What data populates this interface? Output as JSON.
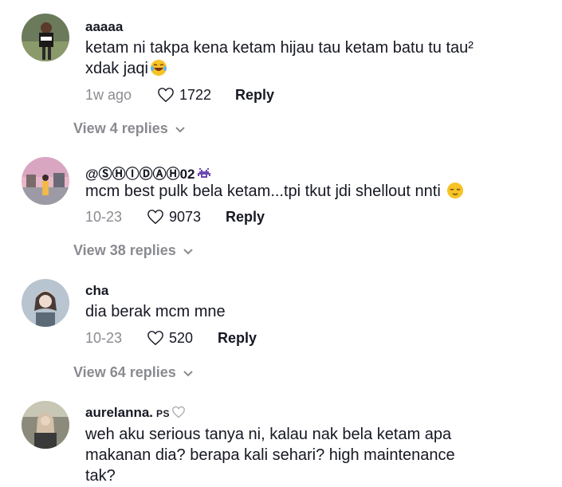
{
  "comments": [
    {
      "username": "aaaaa",
      "text_line1": "ketam ni takpa kena ketam hijau tau ketam batu tu tau²",
      "text_line2": "xdak jaqi",
      "date": "1w ago",
      "likes": "1722",
      "reply_label": "Reply",
      "view_replies": "View 4 replies"
    },
    {
      "username": "@ⓈⒽⒾⒹⒶⒽ02",
      "text_line1": "mcm best pulk bela ketam...tpi tkut jdi shellout nnti",
      "date": "10-23",
      "likes": "9073",
      "reply_label": "Reply",
      "view_replies": "View 38 replies"
    },
    {
      "username": "cha",
      "text_line1": "dia berak mcm mne",
      "date": "10-23",
      "likes": "520",
      "reply_label": "Reply",
      "view_replies": "View 64 replies"
    },
    {
      "username": "aurelanna.",
      "badge": "PS",
      "text_line1": "weh aku serious tanya ni, kalau nak bela ketam apa",
      "text_line2": "makanan dia? berapa kali sehari? high maintenance",
      "text_line3": "tak?"
    }
  ],
  "icons": {
    "like": "heart-outline-icon",
    "expand": "chevron-down-icon",
    "emoji_laugh": "laughing-emoji-icon",
    "emoji_relieved": "relieved-emoji-icon",
    "invader": "space-invader-icon"
  },
  "colors": {
    "text": "#161823",
    "muted": "#8a8b91",
    "background": "#ffffff"
  }
}
